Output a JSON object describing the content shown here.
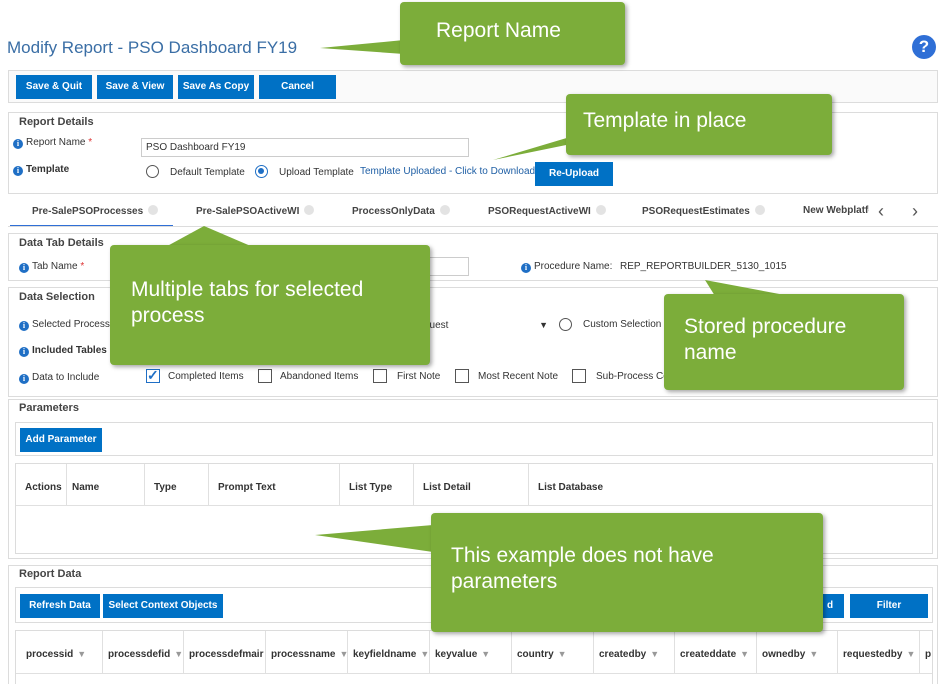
{
  "header": {
    "title": "Modify Report - PSO Dashboard FY19",
    "help_label": "?"
  },
  "toolbar": {
    "save_quit": "Save & Quit",
    "save_view": "Save & View",
    "save_copy": "Save As Copy",
    "cancel": "Cancel"
  },
  "report_details": {
    "title": "Report Details",
    "report_name_label": "Report Name",
    "required_mark": "*",
    "report_name_value": "PSO Dashboard FY19",
    "template_label": "Template",
    "default_template": "Default Template",
    "upload_template": "Upload Template",
    "uploaded_link": "Template Uploaded - Click to Download",
    "reupload": "Re-Upload"
  },
  "tabs": [
    {
      "label": "Pre-SalePSOProcesses"
    },
    {
      "label": "Pre-SalePSOActiveWI"
    },
    {
      "label": "ProcessOnlyData"
    },
    {
      "label": "PSORequestActiveWI"
    },
    {
      "label": "PSORequestEstimates"
    },
    {
      "label": "New Webplatfc"
    }
  ],
  "tab_nav": {
    "prev": "‹",
    "next": "›"
  },
  "data_tab": {
    "title": "Data Tab Details",
    "tab_name_label": "Tab Name",
    "procedure_label": "Procedure Name:",
    "procedure_value": "REP_REPORTBUILDER_5130_1015"
  },
  "data_selection": {
    "title": "Data Selection",
    "selected_process_label": "Selected Process",
    "selected_process_value": "quest",
    "custom_selection": "Custom Selection",
    "included_tables_label": "Included Tables",
    "data_include_label": "Data to Include",
    "options": [
      {
        "label": "Completed Items",
        "checked": true
      },
      {
        "label": "Abandoned Items",
        "checked": false
      },
      {
        "label": "First Note",
        "checked": false
      },
      {
        "label": "Most Recent Note",
        "checked": false
      },
      {
        "label": "Sub-Process Co",
        "checked": false
      }
    ]
  },
  "parameters": {
    "title": "Parameters",
    "add_button": "Add Parameter",
    "columns": [
      "Actions",
      "Name",
      "Type",
      "Prompt Text",
      "List Type",
      "List Detail",
      "List Database"
    ]
  },
  "report_data": {
    "title": "Report Data",
    "refresh": "Refresh Data",
    "select_context": "Select Context Objects",
    "partial_button": "d",
    "filter": "Filter",
    "columns": [
      "processid",
      "processdefid",
      "processdefmair",
      "processname",
      "keyfieldname",
      "keyvalue",
      "country",
      "createdby",
      "createddate",
      "ownedby",
      "requestedby",
      "p"
    ]
  },
  "callouts": {
    "report_name": "Report Name",
    "template": "Template in place",
    "tabs": "Multiple tabs for selected process",
    "procedure": "Stored procedure name",
    "parameters": "This example does not have parameters"
  },
  "colors": {
    "accent": "#0071c5",
    "callout": "#7cad3a",
    "title": "#3a6ea5"
  }
}
